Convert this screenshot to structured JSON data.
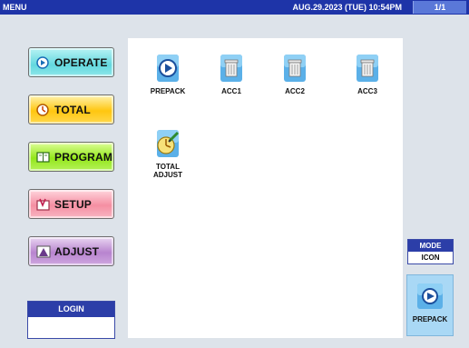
{
  "topbar": {
    "title": "MENU",
    "datetime": "AUG.29.2023 (TUE)  10:54PM",
    "page_indicator": "1/1"
  },
  "nav": {
    "operate": "OPERATE",
    "total": "TOTAL",
    "program": "PROGRAM",
    "setup": "SETUP",
    "adjust": "ADJUST"
  },
  "login": {
    "title": "LOGIN",
    "value": ""
  },
  "icons": [
    {
      "label": "PREPACK",
      "icon": "prepack-icon"
    },
    {
      "label": "ACC1",
      "icon": "trash-icon"
    },
    {
      "label": "ACC2",
      "icon": "trash-icon"
    },
    {
      "label": "ACC3",
      "icon": "trash-icon"
    },
    {
      "label_line1": "TOTAL",
      "label_line2": "ADJUST",
      "icon": "total-adjust-icon"
    }
  ],
  "mode": {
    "title": "MODE",
    "value": "ICON"
  },
  "shortcut": {
    "label": "PREPACK",
    "icon": "prepack-icon"
  },
  "colors": {
    "topbar": "#1e34a8",
    "operate": "#63d8df",
    "total": "#ffc60f",
    "program": "#93e61a",
    "setup": "#f58fa2",
    "adjust": "#b884cf"
  }
}
